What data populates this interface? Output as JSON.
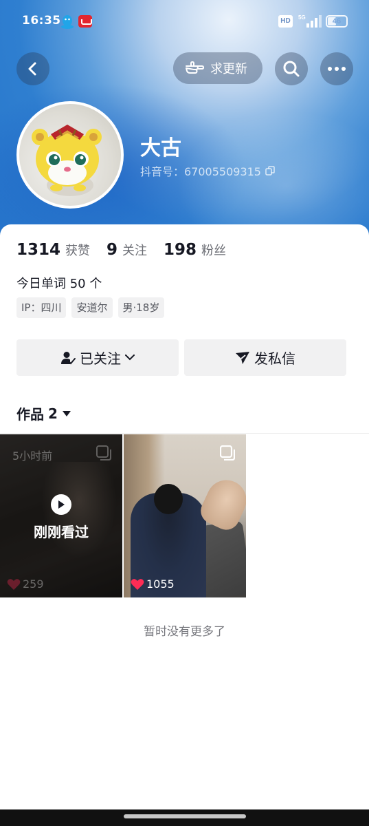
{
  "status_bar": {
    "time": "16:35",
    "hd": "HD",
    "network": "5G",
    "battery": "46",
    "battery_level": 0.46,
    "icons": [
      "qq-icon",
      "app-badge-icon",
      "hd-icon",
      "signal-icon",
      "battery-icon"
    ]
  },
  "nav": {
    "back_icon": "back-arrow-icon",
    "update_label": "求更新",
    "update_icon": "pointing-hand-icon",
    "search_icon": "search-icon",
    "more_icon": "more-dots-icon"
  },
  "profile": {
    "nickname": "大古",
    "douyin_id": "抖音号：67005509315",
    "avatar_icon": "tiger-cartoon-avatar"
  },
  "stats": [
    {
      "value": "1314",
      "label": "获赞"
    },
    {
      "value": "9",
      "label": "关注"
    },
    {
      "value": "198",
      "label": "粉丝"
    }
  ],
  "bio": "今日单词 50 个",
  "tags": [
    "IP：四川",
    "安道尔",
    "男·18岁"
  ],
  "actions": {
    "follow_label": "已关注",
    "message_label": "发私信"
  },
  "works": {
    "label": "作品",
    "count": "2",
    "items": [
      {
        "time_ago": "5小时前",
        "overlay_label": "刚刚看过",
        "likes": "259"
      },
      {
        "likes": "1055"
      }
    ]
  },
  "footer": {
    "no_more": "暂时没有更多了"
  },
  "colors": {
    "header_blue": "#2574cb",
    "like_red": "#fe2c55",
    "text_primary": "#161823",
    "button_bg": "#f1f1f2"
  }
}
